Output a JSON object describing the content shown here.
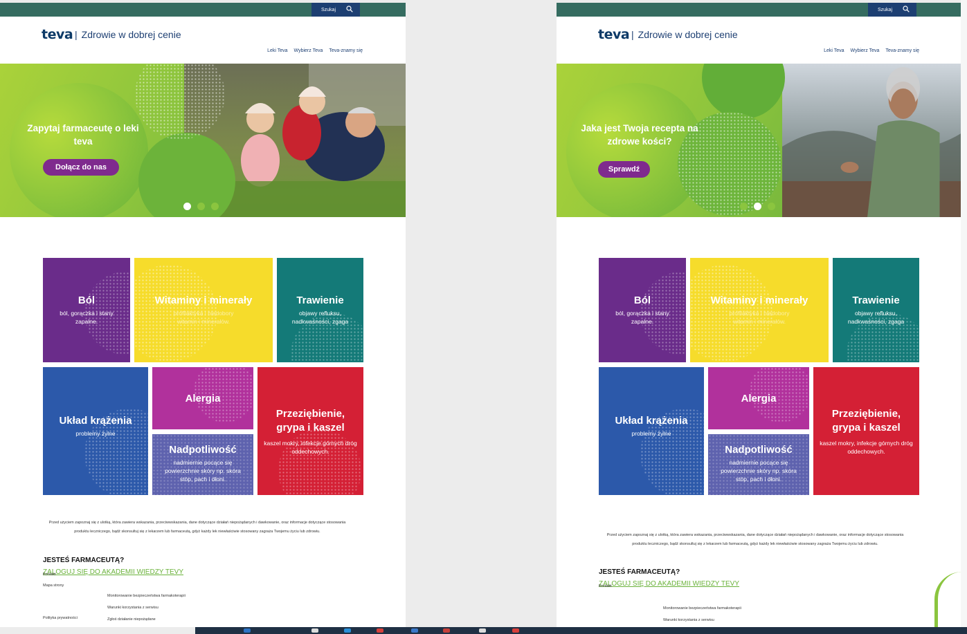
{
  "panels": [
    {
      "search_label": "Szukaj",
      "tagline": "Zdrowie w dobrej cenie",
      "nav": [
        "Leki Teva",
        "Wybierz Teva",
        "Teva-znamy się"
      ],
      "hero": {
        "title": "Zapytaj farmaceutę o leki teva",
        "button": "Dołącz do nas",
        "active_slide": 0
      },
      "tiles": {
        "bol": {
          "title": "Ból",
          "sub": "ból, gorączka i stany zapalne."
        },
        "witaminy": {
          "title": "Witaminy i minerały",
          "sub": "profilaktyka i niedobory witamin i minerałów."
        },
        "trawienie": {
          "title": "Trawienie",
          "sub": "objawy refluksu, nadkwaśności, zgaga"
        },
        "uklad": {
          "title": "Układ krążenia",
          "sub": "problemy żylne"
        },
        "alergia": {
          "title": "Alergia",
          "sub": ""
        },
        "nadpotliwosc": {
          "title": "Nadpotliwość",
          "sub": "nadmiernie pocące się powierzchnie skóry np. skóra stóp, pach i dłoni."
        },
        "przeziebienie": {
          "title": "Przeziębienie, grypa i kaszel",
          "sub": "kaszel mokry, infekcje górnych dróg oddechowych."
        }
      },
      "disclaimer": "Przed użyciem zapoznaj się z ulotką, która zawiera wskazania, przeciwwskazania, dane dotyczące działań niepożądanych i dawkowanie, oraz informacje dotyczące stosowania produktu leczniczego, bądź skonsultuj się z lekarzem lub farmaceutą, gdyż każdy lek niewłaściwie stosowany zagraża Twojemu życiu lub zdrowiu.",
      "farm_title": "JESTEŚ FARMACEUTĄ?",
      "farm_link": "ZALOGUJ SIĘ DO AKADEMII WIEDZY TEVY",
      "footer": {
        "kontakt": "Kontakt",
        "mapa": "Mapa strony",
        "polityka": "Polityka prywatności",
        "monitorowanie": "Monitorowanie bezpieczeństwa farmakoterapii",
        "warunki": "Warunki korzystania z serwisu",
        "zglos": "Zgłoś działanie niepożądane"
      }
    },
    {
      "search_label": "Szukaj",
      "tagline": "Zdrowie w dobrej cenie",
      "nav": [
        "Leki Teva",
        "Wybierz Teva",
        "Teva-znamy się"
      ],
      "hero": {
        "title": "Jaka jest Twoja recepta na zdrowe kości?",
        "button": "Sprawdź",
        "active_slide": 1
      },
      "tiles": {
        "bol": {
          "title": "Ból",
          "sub": "ból, gorączka i stany zapalne."
        },
        "witaminy": {
          "title": "Witaminy i minerały",
          "sub": "profilaktyka i niedobory witamin i minerałów."
        },
        "trawienie": {
          "title": "Trawienie",
          "sub": "objawy refluksu, nadkwaśności, zgaga"
        },
        "uklad": {
          "title": "Układ krążenia",
          "sub": "problemy żylne"
        },
        "alergia": {
          "title": "Alergia",
          "sub": ""
        },
        "nadpotliwosc": {
          "title": "Nadpotliwość",
          "sub": "nadmiernie pocące się powierzchnie skóry np. skóra stóp, pach i dłoni."
        },
        "przeziebienie": {
          "title": "Przeziębienie, grypa i kaszel",
          "sub": "kaszel mokry, infekcje górnych dróg oddechowych."
        }
      },
      "disclaimer": "Przed użyciem zapoznaj się z ulotką, która zawiera wskazania, przeciwwskazania, dane dotyczące działań niepożądanych i dawkowanie, oraz informacje dotyczące stosowania produktu leczniczego, bądź skonsultuj się z lekarzem lub farmaceutą, gdyż każdy lek niewłaściwie stosowany zagraża Twojemu życiu lub zdrowiu.",
      "farm_title": "JESTEŚ FARMACEUTĄ?",
      "farm_link": "ZALOGUJ SIĘ DO AKADEMII WIEDZY TEVY",
      "footer": {
        "kontakt": "Kontakt",
        "monitorowanie": "Monitorowanie bezpieczeństwa farmakoterapii",
        "warunki": "Warunki korzystania z serwisu"
      }
    }
  ],
  "colors": {
    "topbar": "#356c60",
    "navy": "#1d3f72",
    "purple_btn": "#7f2a8e",
    "bol": "#6a2c8a",
    "witaminy": "#f6dc2b",
    "trawienie": "#147a78",
    "uklad": "#2c59aa",
    "alergia": "#b1319c",
    "nadpotliwosc": "#5e62ae",
    "przeziebienie": "#d42035",
    "link_green": "#6ab23a"
  }
}
